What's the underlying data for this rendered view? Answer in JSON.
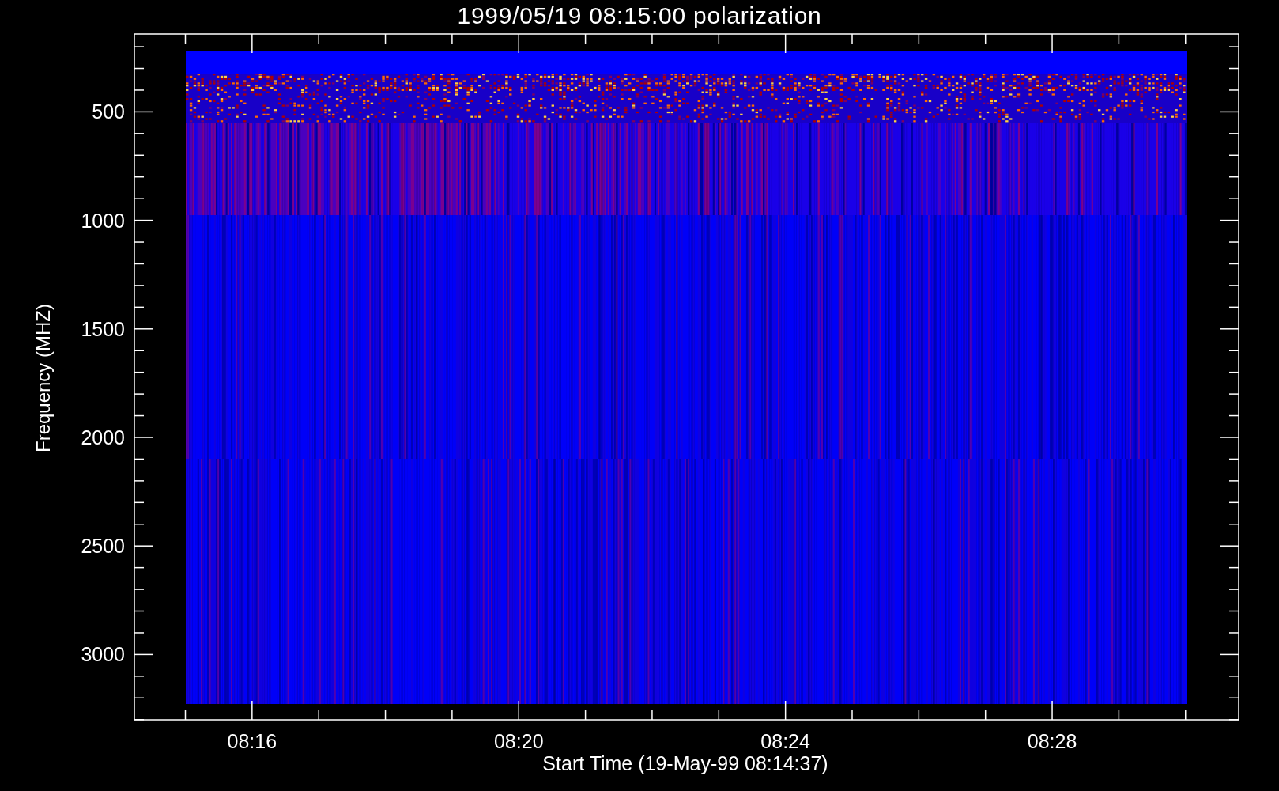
{
  "title": "1999/05/19 08:15:00 polarization",
  "plot": {
    "ylabel": "Frequency (MHZ)",
    "xlabel": "Start Time (19-May-99 08:14:37)",
    "yticks": [
      "500",
      "1000",
      "1500",
      "2000",
      "2500",
      "3000"
    ],
    "xticks": [
      "08:16",
      "08:20",
      "08:24",
      "08:28"
    ]
  }
}
